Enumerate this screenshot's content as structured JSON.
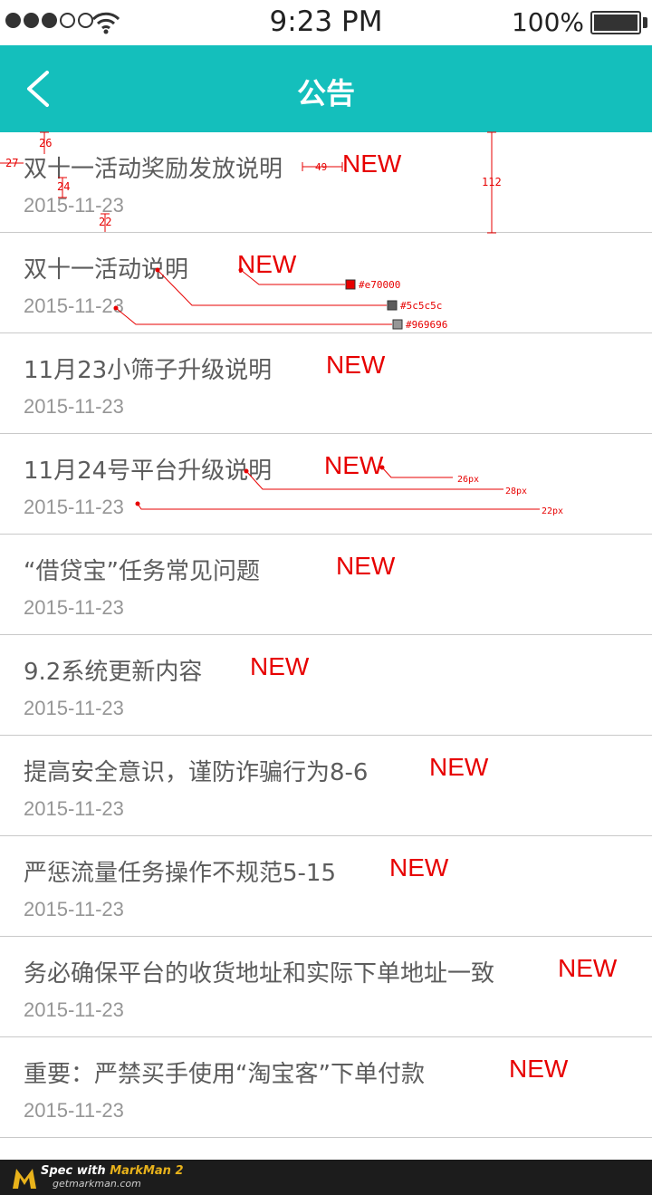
{
  "status_bar": {
    "time": "9:23 PM",
    "battery": "100%"
  },
  "nav": {
    "title": "公告",
    "back_icon": "chevron-left-icon"
  },
  "colors": {
    "accent": "#14bfbc",
    "badge": "#e70000",
    "title_text": "#5c5c5c",
    "date_text": "#969696"
  },
  "notices": [
    {
      "title": "双十一活动奖励发放说明",
      "badge": "NEW",
      "date": "2015-11-23"
    },
    {
      "title": "双十一活动说明",
      "badge": "NEW",
      "date": "2015-11-23"
    },
    {
      "title": "11月23小筛子升级说明",
      "badge": "NEW",
      "date": "2015-11-23"
    },
    {
      "title": "11月24号平台升级说明",
      "badge": "NEW",
      "date": "2015-11-23"
    },
    {
      "title": "“借贷宝”任务常见问题",
      "badge": "NEW",
      "date": "2015-11-23"
    },
    {
      "title": "9.2系统更新内容",
      "badge": "NEW",
      "date": "2015-11-23"
    },
    {
      "title": "提高安全意识，谨防诈骗行为8-6",
      "badge": "NEW",
      "date": "2015-11-23"
    },
    {
      "title": "严惩流量任务操作不规范5-15",
      "badge": "NEW",
      "date": "2015-11-23"
    },
    {
      "title": "务必确保平台的收货地址和实际下单地址一致",
      "badge": "NEW",
      "date": "2015-11-23"
    },
    {
      "title": "重要：严禁买手使用“淘宝客”下单付款",
      "badge": "NEW",
      "date": "2015-11-23"
    }
  ],
  "spec_annotations": {
    "m26": "26",
    "m27": "27",
    "m24": "24",
    "m22": "22",
    "m49": "49",
    "m112": "112",
    "c1": "#e70000",
    "c2": "#5c5c5c",
    "c3": "#969696",
    "f26": "26px",
    "f28": "28px",
    "f22": "22px"
  },
  "footer": {
    "line1_prefix": "Spec with ",
    "line1_brand": "MarkMan 2",
    "line2": "getmarkman.com"
  }
}
